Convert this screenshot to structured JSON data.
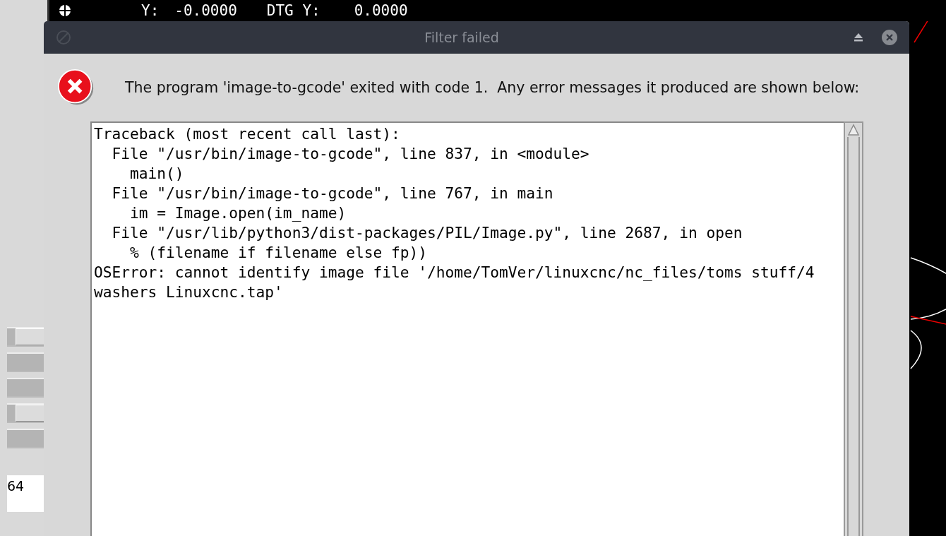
{
  "background": {
    "position_readout": [
      {
        "label": "Y:",
        "value": "-0.0000"
      },
      {
        "label": "DTG Y:",
        "value": "0.0000"
      }
    ],
    "side_text": "64"
  },
  "dialog": {
    "title": "Filter failed",
    "message": "The program 'image-to-gcode' exited with code 1.  Any error messages it produced are shown below:",
    "output_lines": [
      "Traceback (most recent call last):",
      "  File \"/usr/bin/image-to-gcode\", line 837, in <module>",
      "    main()",
      "  File \"/usr/bin/image-to-gcode\", line 767, in main",
      "    im = Image.open(im_name)",
      "  File \"/usr/lib/python3/dist-packages/PIL/Image.py\", line 2687, in open",
      "    % (filename if filename else fp))",
      "OSError: cannot identify image file '/home/TomVer/linuxcnc/nc_files/toms stuff/4",
      "washers Linuxcnc.tap'"
    ]
  }
}
